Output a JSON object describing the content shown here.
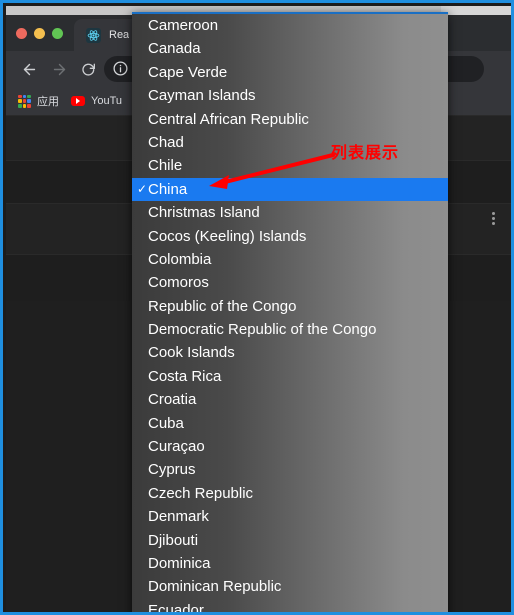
{
  "window": {
    "traffic_lights": [
      "close",
      "minimize",
      "maximize"
    ],
    "tab": {
      "title": "Rea",
      "favicon": "react-icon"
    },
    "toolbar": {
      "back_icon": "back-arrow-icon",
      "forward_icon": "forward-arrow-icon",
      "reload_icon": "reload-icon",
      "site_info_icon": "info-circle-icon",
      "address_value": ""
    },
    "bookmarks": [
      {
        "label": "应用",
        "icon": "apps-grid-icon"
      },
      {
        "label": "YouTu",
        "icon": "youtube-icon"
      }
    ],
    "page_menu_icon": "kebab-menu-icon"
  },
  "dropdown": {
    "name": "country-select-popup",
    "selected": "China",
    "selected_check_glyph": "✓",
    "options": [
      "Cameroon",
      "Canada",
      "Cape Verde",
      "Cayman Islands",
      "Central African Republic",
      "Chad",
      "Chile",
      "China",
      "Christmas Island",
      "Cocos (Keeling) Islands",
      "Colombia",
      "Comoros",
      "Republic of the Congo",
      "Democratic Republic of the Congo",
      "Cook Islands",
      "Costa Rica",
      "Croatia",
      "Cuba",
      "Curaçao",
      "Cyprus",
      "Czech Republic",
      "Denmark",
      "Djibouti",
      "Dominica",
      "Dominican Republic",
      "Ecuador"
    ]
  },
  "annotation": {
    "text": "列表展示",
    "color": "#ff0000",
    "arrow": "red-arrow-pointing-to-selected-option"
  },
  "colors": {
    "capture_border": "#1f8fe0",
    "highlight": "#1a7af0",
    "browser_chrome": "#35363a",
    "page_background": "#1f1f1f",
    "annotation_red": "#ff0000"
  }
}
